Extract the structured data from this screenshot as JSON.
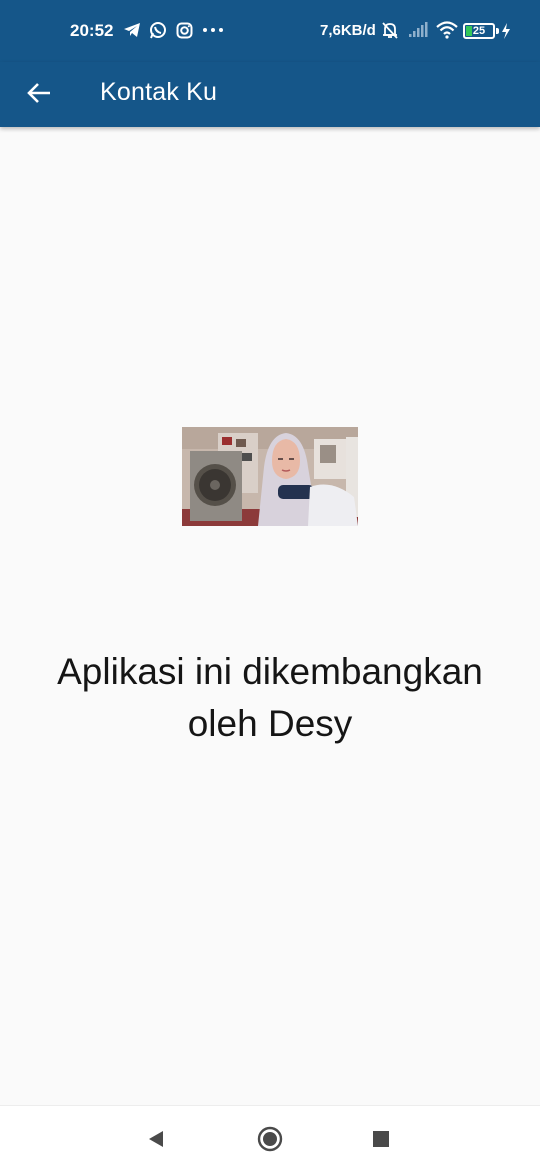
{
  "status_bar": {
    "time": "20:52",
    "network_speed": "7,6KB/d",
    "battery_level": "25",
    "left_icons": [
      "telegram-icon",
      "whatsapp-icon",
      "instagram-icon",
      "more-dots-icon"
    ],
    "right_icons": [
      "muted-bell-icon",
      "signal-icon",
      "wifi-icon",
      "battery-icon",
      "charging-icon"
    ]
  },
  "app_bar": {
    "title": "Kontak Ku",
    "color": "#155689"
  },
  "content": {
    "photo_alt": "",
    "developer_text_line1": "Aplikasi ini dikembangkan",
    "developer_text_line2": "oleh Desy"
  },
  "nav_bar": {
    "buttons": [
      "back-triangle-icon",
      "home-circle-icon",
      "recents-square-icon"
    ]
  }
}
